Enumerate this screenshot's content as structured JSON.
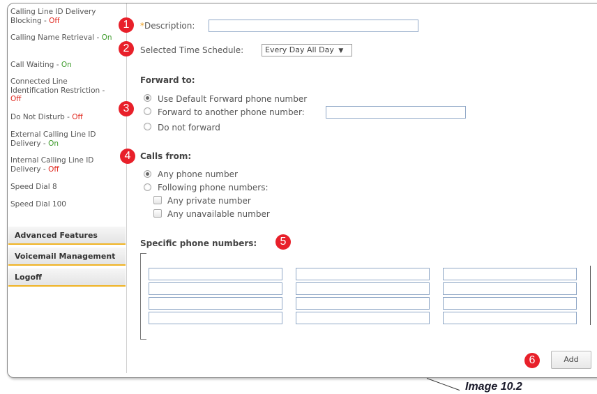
{
  "sidebar": {
    "features": [
      {
        "label": "Calling Line ID Delivery Blocking - ",
        "status": "Off"
      },
      {
        "label": "Calling Name Retrieval - ",
        "status": "On"
      },
      {
        "label": "Call Waiting - ",
        "status": "On"
      },
      {
        "label": "Connected Line Identification Restriction - ",
        "status": "Off"
      },
      {
        "label": "Do Not Disturb - ",
        "status": "Off"
      },
      {
        "label": "External Calling Line ID Delivery - ",
        "status": "On"
      },
      {
        "label": "Internal Calling Line ID Delivery - ",
        "status": "Off"
      },
      {
        "label": "Speed Dial 8",
        "status": ""
      },
      {
        "label": "Speed Dial 100",
        "status": ""
      }
    ],
    "menu": [
      "Advanced Features",
      "Voicemail Management",
      "Logoff"
    ]
  },
  "form": {
    "required_mark": "*",
    "description_label": "Description:",
    "description_value": "",
    "schedule_label": "Selected Time Schedule:",
    "schedule_value": "Every Day All Day",
    "forward_title": "Forward to:",
    "forward_options": [
      "Use Default Forward phone number",
      "Forward to another phone number:",
      "Do not forward"
    ],
    "forward_selected": 0,
    "forward_number_value": "",
    "calls_from_title": "Calls from:",
    "calls_from_options": [
      "Any phone number",
      "Following phone numbers:"
    ],
    "calls_from_selected": 0,
    "calls_from_checks": [
      "Any private number",
      "Any unavailable number"
    ],
    "specific_title": "Specific phone numbers:",
    "add_label": "Add"
  },
  "badges": [
    "1",
    "2",
    "3",
    "4",
    "5",
    "6"
  ],
  "caption": "Image 10.2",
  "colors": {
    "on": "#3c9a2a",
    "off": "#e0281e",
    "badge": "#e8202a",
    "menu_accent": "#f0b322"
  },
  "icons": {
    "dropdown": "caret-down-icon"
  }
}
